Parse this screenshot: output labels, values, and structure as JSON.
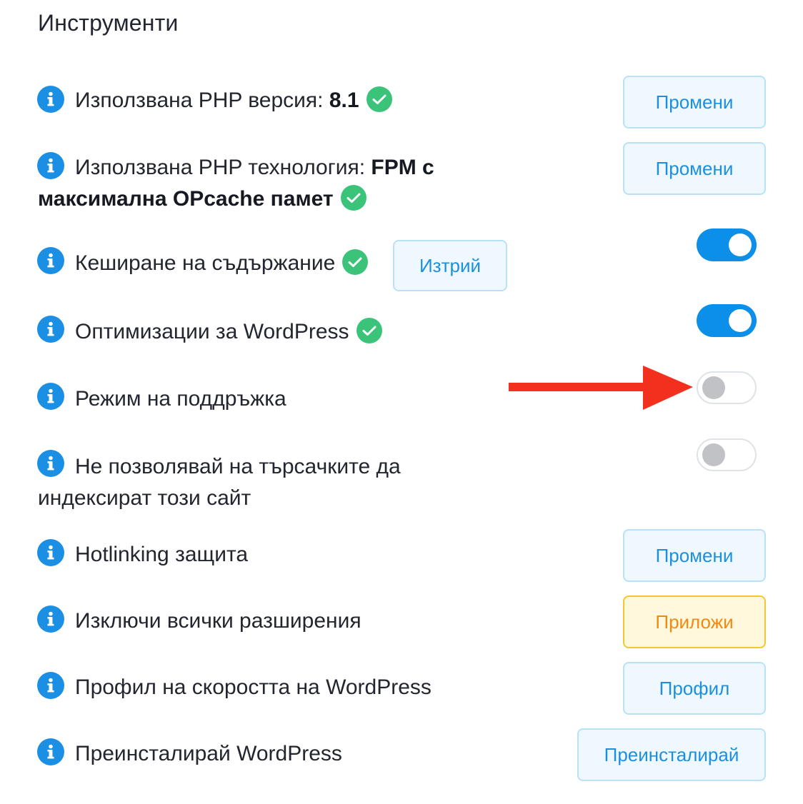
{
  "section": {
    "title": "Инструменти"
  },
  "rows": {
    "php_version": {
      "label": "Използвана PHP версия: ",
      "value": "8.1",
      "status": "ok",
      "button": "Промени"
    },
    "php_tech": {
      "label": "Използвана PHP технология: ",
      "value_line1": "FPM с",
      "value_line2": "максимална OPcache памет",
      "status": "ok",
      "button": "Промени"
    },
    "caching": {
      "label": "Кеширане на съдържание",
      "status": "ok",
      "button": "Изтрий",
      "toggle_on": true
    },
    "wp_opt": {
      "label": "Оптимизации за WordPress",
      "status": "ok",
      "toggle_on": true
    },
    "maintenance": {
      "label": "Режим на поддръжка",
      "toggle_on": false
    },
    "noindex": {
      "label_line1": "Не позволявай на търсачките да",
      "label_line2": "индексират този сайт",
      "toggle_on": false
    },
    "hotlink": {
      "label": "Hotlinking защита",
      "button": "Промени"
    },
    "disable_plugins": {
      "label": "Изключи всички разширения",
      "button": "Приложи"
    },
    "speed_profile": {
      "label": "Профил на скоростта на WordPress",
      "button": "Профил"
    },
    "reinstall": {
      "label": "Преинсталирай WordPress",
      "button": "Преинсталирай"
    }
  },
  "icons": {
    "info": "info-icon",
    "check": "check-circle-icon",
    "annotation": "red-arrow-icon"
  },
  "colors": {
    "accent": "#0b8fe8",
    "button_text": "#1d8fe0",
    "button_bg": "#eef8fe",
    "warn_bg": "#fff8dc",
    "warn_border": "#f4c736",
    "warn_text": "#f08a12",
    "success": "#3cc37a",
    "arrow": "#f2301d"
  }
}
